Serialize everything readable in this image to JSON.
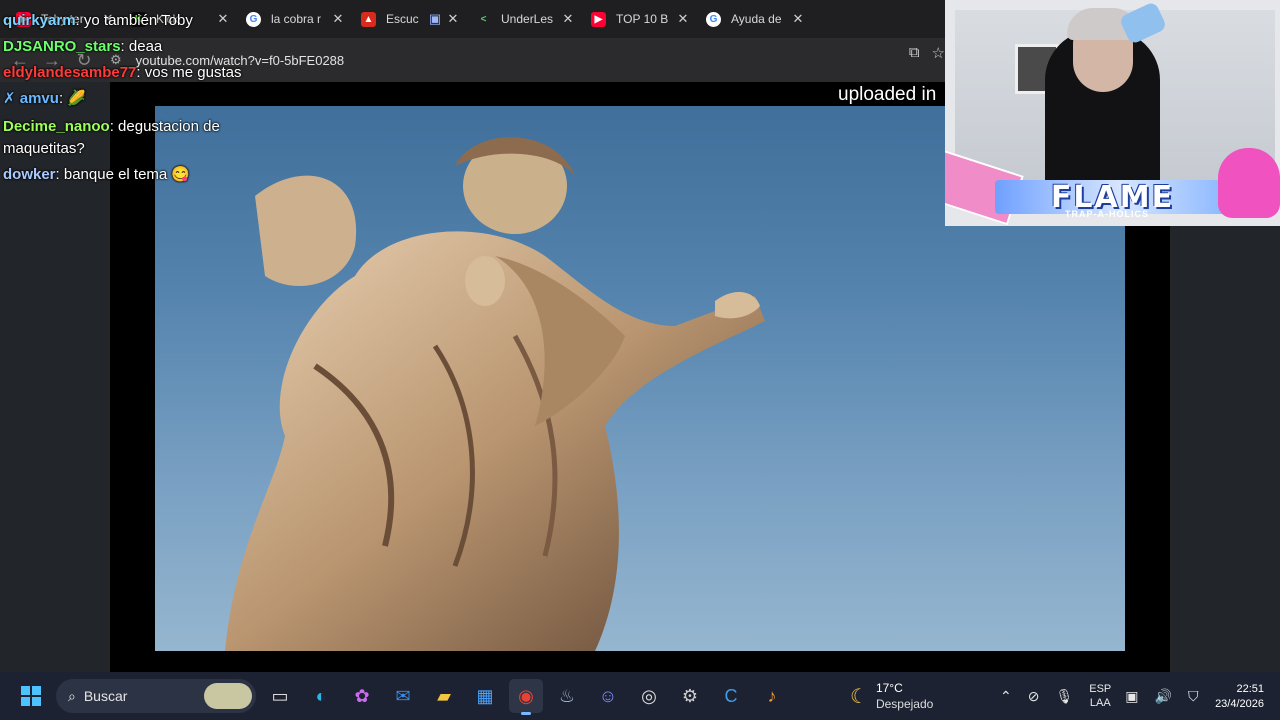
{
  "browser": {
    "tabs": [
      {
        "label": "YouTube",
        "icon": "youtube-icon",
        "color": "#ff0033"
      },
      {
        "label": "Kick",
        "icon": "kick-icon",
        "color": "#53fc18"
      },
      {
        "label": "la cobra r",
        "icon": "google-icon",
        "color": "#4285f4"
      },
      {
        "label": "Escuc",
        "icon": "red-icon",
        "color": "#d92b1c"
      },
      {
        "label": "UnderLes",
        "icon": "underlet-icon",
        "color": "#2a7f3a"
      },
      {
        "label": "TOP 10 B",
        "icon": "youtube-icon",
        "color": "#ff0033"
      },
      {
        "label": "Ayuda de",
        "icon": "google-icon",
        "color": "#4285f4"
      }
    ],
    "first_tab_partial": "Toby ter",
    "url": "youtube.com/watch?v=f0-5bFE0288"
  },
  "video": {
    "uploaded_text": "uploaded in"
  },
  "chat": [
    {
      "user": "quirkyarm",
      "text": " yo también Toby",
      "color": "#7fd3ff"
    },
    {
      "user": "DJSANRO_stars",
      "text": " deaa",
      "color": "#6cff6c"
    },
    {
      "user": "eldylandesambe77",
      "text": " vos me gustas",
      "color": "#ff3b3b"
    },
    {
      "user": "amvu",
      "text": " 🌽",
      "color": "#6ab8ff"
    },
    {
      "user": "Decime_nanoo",
      "text": " degustacion de maquetitas?",
      "color": "#9dff58"
    },
    {
      "user": "dowker",
      "text": " banque el tema 😋",
      "color": "#a9c9ff"
    }
  ],
  "overlay": {
    "title": "FLAME",
    "subtitle": "TRAP-A-HOLICS"
  },
  "taskbar": {
    "search_label": "Buscar",
    "weather_temp": "17°C",
    "weather_desc": "Despejado",
    "lang_top": "ESP",
    "lang_bottom": "LAA",
    "time": "22:51",
    "date": "23/4/2026"
  }
}
